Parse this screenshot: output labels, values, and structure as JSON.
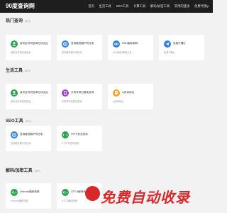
{
  "app": {
    "logo": "90度查询网"
  },
  "nav": [
    "首页",
    "生活工具",
    "SEO工具",
    "计算工具",
    "解码/加密工具",
    "常用的链接",
    "免费代理ip"
  ],
  "sections": [
    {
      "title": "热门查询",
      "count": "(847)",
      "cards": [
        {
          "name": "身份证号码查询在线认证",
          "desc": "身份证号码在线验证",
          "icon": "person-icon",
          "color": "#2aa44c"
        },
        {
          "name": "查询服务器IP所在地",
          "desc": "查询服务器IP所在地",
          "icon": "globe-icon",
          "color": "#2f7fe0"
        },
        {
          "name": "URL编码/解码",
          "desc": "URL编码/解码工具",
          "icon": "link-icon",
          "color": "#2f7fe0"
        },
        {
          "name": "免费代理ip",
          "desc": "免费代理ip",
          "icon": "send-icon",
          "color": "#2f7fe0"
        }
      ]
    },
    {
      "title": "生活工具",
      "count": "(807)",
      "cards": [
        {
          "name": "身份证号码查询在线认证",
          "desc": "身份证号码在线验证",
          "icon": "person-icon",
          "color": "#2aa44c"
        },
        {
          "name": "手机号码归属地查询",
          "desc": "手机号码归属地查询",
          "icon": "phone-icon",
          "color": "#9b46c9"
        },
        {
          "name": "ip查询地址",
          "desc": "ip查询地址",
          "icon": "location-icon",
          "color": "#f1a22b"
        }
      ]
    },
    {
      "title": "SEO工具",
      "count": "(827)",
      "cards": [
        {
          "name": "查询服务器IP所在地",
          "desc": "查询服务器IP所在地",
          "icon": "globe-icon",
          "color": "#2f7fe0"
        },
        {
          "name": "HTTP状态查询",
          "desc": "HTTP状态码查询",
          "icon": "http-icon",
          "color": "#2aa44c"
        }
      ]
    },
    {
      "title": "解码/加密工具",
      "count": "(847)",
      "cards": [
        {
          "name": "Unicode编码转换",
          "desc": "Unicode编码转换",
          "icon": "code-icon",
          "color": "#2aa44c"
        },
        {
          "name": "UTF-8编码转换",
          "desc": "UTF-8编码转换",
          "icon": "code-icon",
          "color": "#2aa44c"
        }
      ]
    }
  ],
  "watermark": "免费自动收录"
}
